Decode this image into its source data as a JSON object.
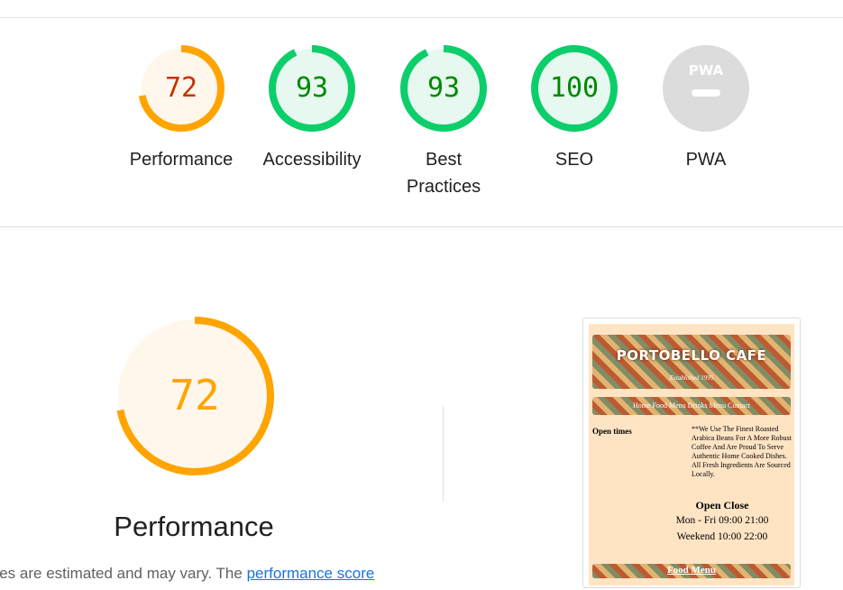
{
  "summary": {
    "gauges": [
      {
        "label": "Performance",
        "score": "72",
        "fraction": 0.72,
        "color": "#ffa400",
        "fill": "#fff7ec",
        "text_color": "#c33300"
      },
      {
        "label": "Accessibility",
        "score": "93",
        "fraction": 0.93,
        "color": "#0cce6b",
        "fill": "#e6f8ef",
        "text_color": "#008800"
      },
      {
        "label": "Best Practices",
        "score": "93",
        "fraction": 0.93,
        "color": "#0cce6b",
        "fill": "#e6f8ef",
        "text_color": "#008800"
      },
      {
        "label": "SEO",
        "score": "100",
        "fraction": 1.0,
        "color": "#0cce6b",
        "fill": "#e6f8ef",
        "text_color": "#008800"
      }
    ],
    "pwa": {
      "label": "PWA",
      "badge_text": "PWA",
      "badge_color": "#dcdcdc"
    }
  },
  "performance": {
    "score": "72",
    "fraction": 0.72,
    "title": "Performance",
    "description_prefix": "lues are estimated and may vary. The ",
    "description_link": "performance score"
  },
  "screenshot": {
    "site_title": "PORTOBELLO CAFE",
    "established": "Established 1995",
    "nav": "Home Food Menu Drinks Menu Contact",
    "open_times_label": "Open times",
    "intro": "**We Use The Finest Roasted Arabica Beans For A More Robust Coffee And Are Proud To Serve Authentic Home Cooked Dishes. All Fresh Ingredients Are Sourced Locally.",
    "open_close_header": "Open Close",
    "hours": [
      {
        "text": "Mon - Fri 09:00 21:00"
      },
      {
        "text": "Weekend  10:00 22:00"
      }
    ],
    "footer_link": "Food Menu"
  }
}
